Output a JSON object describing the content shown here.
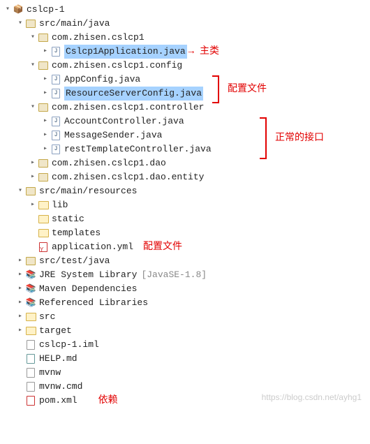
{
  "project": "cslcp-1",
  "srcMainJava": "src/main/java",
  "pkg1": "com.zhisen.cslcp1",
  "file_app": "Cslcp1Application.java",
  "annot_main": "主类",
  "pkg_config": "com.zhisen.cslcp1.config",
  "file_appconfig": "AppConfig.java",
  "file_resconfig": "ResourceServerConfig.java",
  "annot_config": "配置文件",
  "pkg_controller": "com.zhisen.cslcp1.controller",
  "file_account": "AccountController.java",
  "file_msgsender": "MessageSender.java",
  "file_resttmpl": "restTemplateController.java",
  "annot_api": "正常的接口",
  "pkg_dao": "com.zhisen.cslcp1.dao",
  "pkg_entity": "com.zhisen.cslcp1.dao.entity",
  "srcMainRes": "src/main/resources",
  "res_lib": "lib",
  "res_static": "static",
  "res_templates": "templates",
  "res_yml": "application.yml",
  "annot_yml": "配置文件",
  "srcTestJava": "src/test/java",
  "jre": "JRE System Library",
  "jre_qual": "[JavaSE-1.8]",
  "maven": "Maven Dependencies",
  "reflib": "Referenced Libraries",
  "folder_src": "src",
  "folder_target": "target",
  "file_iml": "cslcp-1.iml",
  "file_help": "HELP.md",
  "file_mvnw": "mvnw",
  "file_mvnwcmd": "mvnw.cmd",
  "file_pom": "pom.xml",
  "annot_dep": "依赖",
  "watermark": "https://blog.csdn.net/ayhg1"
}
